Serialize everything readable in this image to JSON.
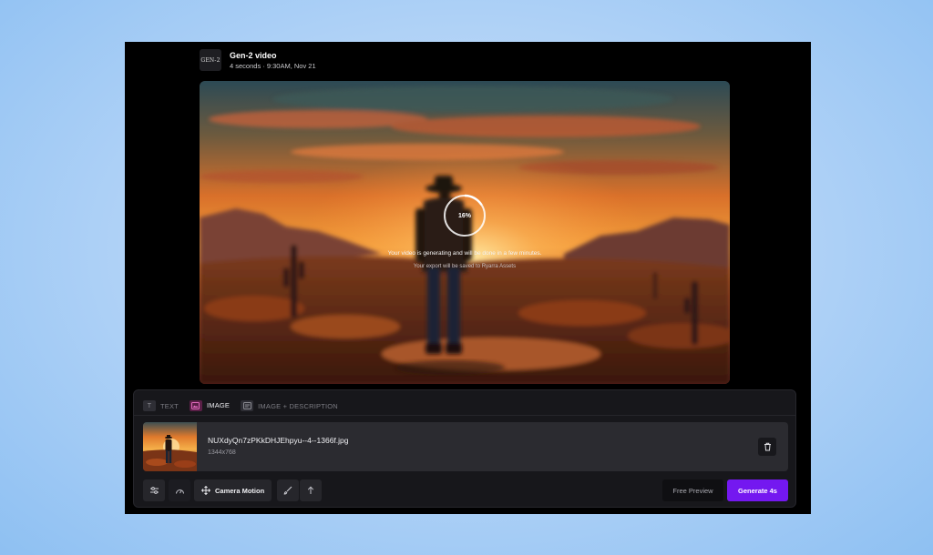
{
  "header": {
    "logo_text": "GEN-2",
    "title": "Gen-2 video",
    "subtitle": "4 seconds · 9:30AM, Nov 21"
  },
  "video": {
    "progress_label": "16%",
    "progress_fraction": 0.16,
    "message": "Your video is generating and will be done in a few minutes.",
    "export_note": "Your export will be saved to Ryarra Assets"
  },
  "tabs": [
    {
      "label": "TEXT",
      "icon": "text-icon",
      "active": false
    },
    {
      "label": "IMAGE",
      "icon": "image-icon",
      "active": true
    },
    {
      "label": "IMAGE + DESCRIPTION",
      "icon": "image-description-icon",
      "active": false
    }
  ],
  "file": {
    "name": "NUXdyQn7zPKkDHJEhpyu--4--1366f.jpg",
    "dimensions": "1344x768"
  },
  "toolbar": {
    "settings_icon": "sliders-icon",
    "speed_icon": "gauge-icon",
    "camera_motion_label": "Camera Motion",
    "camera_icon": "move-icon",
    "brush_icon": "brush-icon",
    "upload_icon": "arrow-up-icon",
    "free_preview_label": "Free Preview",
    "generate_label": "Generate 4s"
  },
  "colors": {
    "accent": "#7418f0",
    "active_tab": "#c6449a",
    "background": "#000000",
    "panel": "#17171b"
  }
}
